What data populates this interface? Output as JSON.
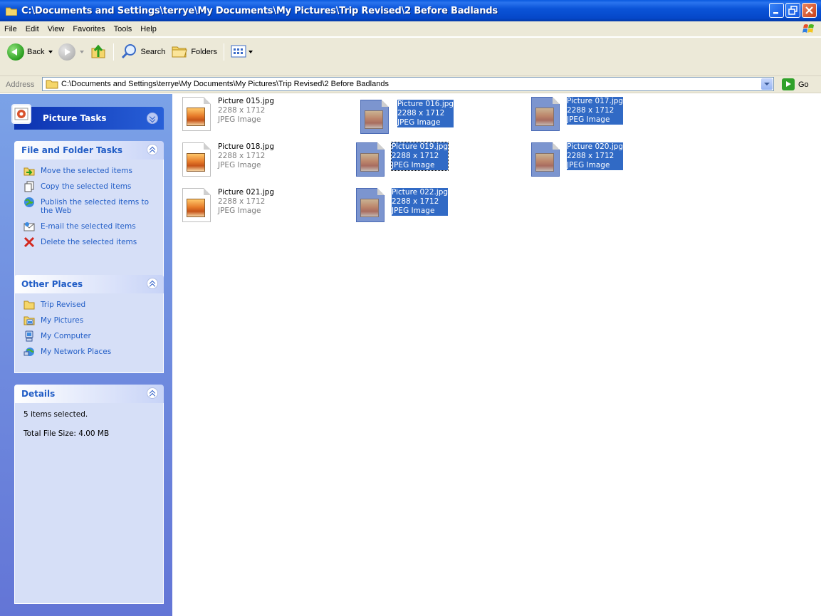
{
  "window": {
    "title": "C:\\Documents and Settings\\terrye\\My Documents\\My Pictures\\Trip Revised\\2 Before Badlands"
  },
  "menu": [
    "File",
    "Edit",
    "View",
    "Favorites",
    "Tools",
    "Help"
  ],
  "toolbar": {
    "back_label": "Back",
    "search_label": "Search",
    "folders_label": "Folders"
  },
  "address": {
    "label": "Address",
    "value": "C:\\Documents and Settings\\terrye\\My Documents\\My Pictures\\Trip Revised\\2 Before Badlands",
    "go_label": "Go"
  },
  "picture_tasks": {
    "title": "Picture Tasks"
  },
  "file_tasks": {
    "title": "File and Folder Tasks",
    "items": [
      {
        "label": "Move the selected items",
        "icon": "move-icon"
      },
      {
        "label": "Copy the selected items",
        "icon": "copy-icon"
      },
      {
        "label": "Publish the selected items to the Web",
        "icon": "publish-web-icon"
      },
      {
        "label": "E-mail the selected items",
        "icon": "email-icon"
      },
      {
        "label": "Delete the selected items",
        "icon": "delete-icon"
      }
    ]
  },
  "other_places": {
    "title": "Other Places",
    "items": [
      {
        "label": "Trip Revised",
        "icon": "folder-icon"
      },
      {
        "label": "My Pictures",
        "icon": "my-pictures-icon"
      },
      {
        "label": "My Computer",
        "icon": "my-computer-icon"
      },
      {
        "label": "My Network Places",
        "icon": "network-places-icon"
      }
    ]
  },
  "details": {
    "title": "Details",
    "selected_text": "5 items selected.",
    "total_size_text": "Total File Size: 4.00 MB"
  },
  "files": [
    {
      "name": "Picture 015.jpg",
      "dims": "2288 x 1712",
      "type": "JPEG Image",
      "selected": false
    },
    {
      "name": "Picture 016.jpg",
      "dims": "2288 x 1712",
      "type": "JPEG Image",
      "selected": true
    },
    {
      "name": "Picture 017.jpg",
      "dims": "2288 x 1712",
      "type": "JPEG Image",
      "selected": true
    },
    {
      "name": "Picture 018.jpg",
      "dims": "2288 x 1712",
      "type": "JPEG Image",
      "selected": false
    },
    {
      "name": "Picture 019.jpg",
      "dims": "2288 x 1712",
      "type": "JPEG Image",
      "selected": true
    },
    {
      "name": "Picture 020.jpg",
      "dims": "2288 x 1712",
      "type": "JPEG Image",
      "selected": true
    },
    {
      "name": "Picture 021.jpg",
      "dims": "2288 x 1712",
      "type": "JPEG Image",
      "selected": false
    },
    {
      "name": "Picture 022.jpg",
      "dims": "2288 x 1712",
      "type": "JPEG Image",
      "selected": true
    }
  ],
  "colors": {
    "title_bar": "#0b54d8",
    "selection": "#316ac5",
    "task_link": "#215dc6",
    "pane_bg": "#7ba2e7"
  }
}
